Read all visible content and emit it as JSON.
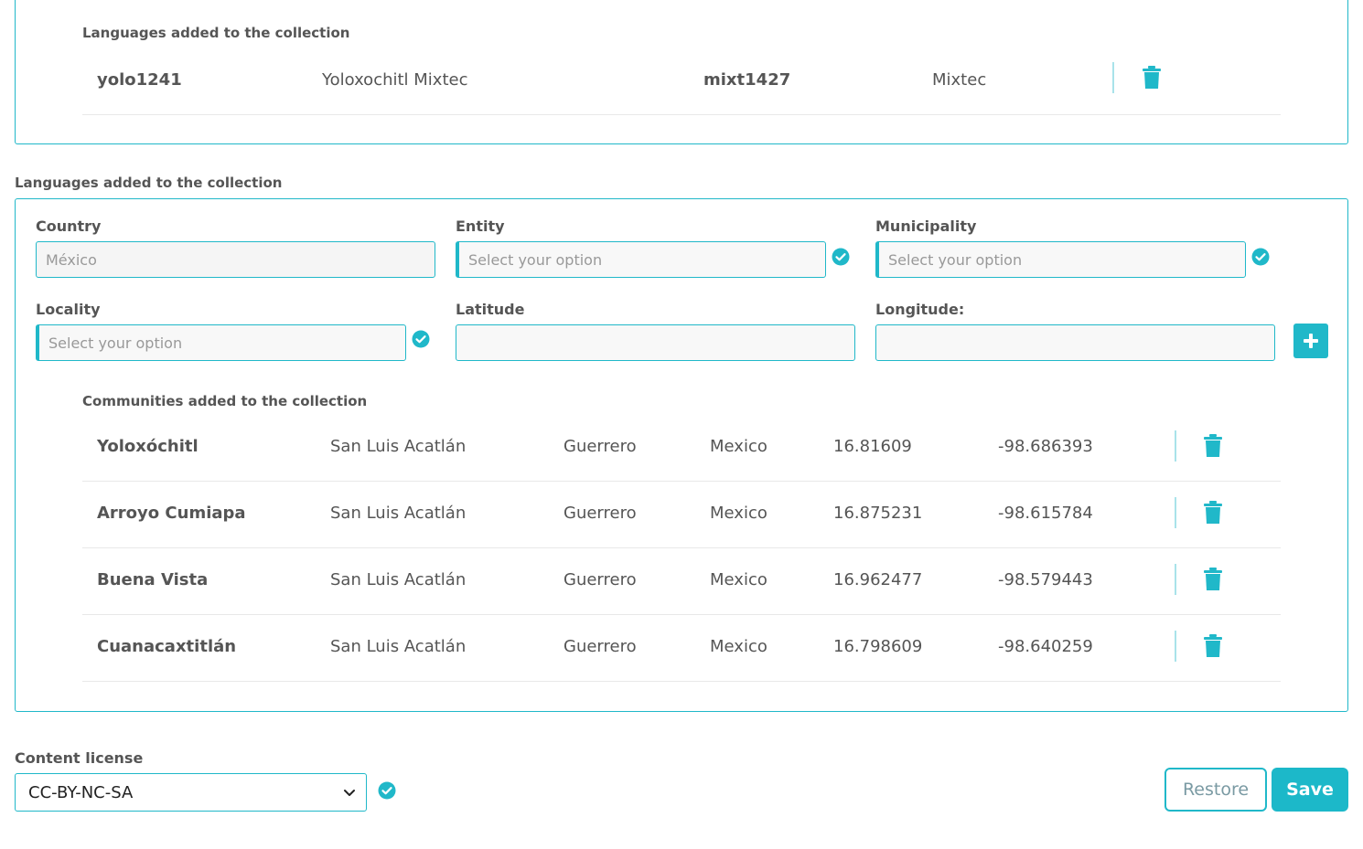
{
  "languages_panel": {
    "title": "Languages added to the collection",
    "row": {
      "code": "yolo1241",
      "name": "Yoloxochitl Mixtec",
      "family_code": "mixt1427",
      "family": "Mixtec"
    }
  },
  "location_section": {
    "title": "Languages added to the collection",
    "country": {
      "label": "Country",
      "value": "México"
    },
    "entity": {
      "label": "Entity",
      "placeholder": "Select your option"
    },
    "municipality": {
      "label": "Municipality",
      "placeholder": "Select your option"
    },
    "locality": {
      "label": "Locality",
      "placeholder": "Select your option"
    },
    "latitude": {
      "label": "Latitude",
      "value": ""
    },
    "longitude": {
      "label": "Longitude:",
      "value": ""
    },
    "communities_title": "Communities added to the collection",
    "communities": [
      {
        "name": "Yoloxóchitl",
        "municipality": "San Luis Acatlán",
        "state": "Guerrero",
        "country": "Mexico",
        "lat": "16.81609",
        "lon": "-98.686393"
      },
      {
        "name": "Arroyo Cumiapa",
        "municipality": "San Luis Acatlán",
        "state": "Guerrero",
        "country": "Mexico",
        "lat": "16.875231",
        "lon": "-98.615784"
      },
      {
        "name": "Buena Vista",
        "municipality": "San Luis Acatlán",
        "state": "Guerrero",
        "country": "Mexico",
        "lat": "16.962477",
        "lon": "-98.579443"
      },
      {
        "name": "Cuanacaxtitlán",
        "municipality": "San Luis Acatlán",
        "state": "Guerrero",
        "country": "Mexico",
        "lat": "16.798609",
        "lon": "-98.640259"
      }
    ]
  },
  "license": {
    "label": "Content license",
    "value": "CC-BY-NC-SA"
  },
  "actions": {
    "restore": "Restore",
    "save": "Save"
  },
  "colors": {
    "accent": "#20b8c9",
    "text": "#555555",
    "separator": "#e8e8e8"
  },
  "icons": {
    "trash": "trash-icon",
    "check": "check-circle-icon",
    "add": "plus-icon",
    "dropdown": "chevron-down-icon"
  }
}
